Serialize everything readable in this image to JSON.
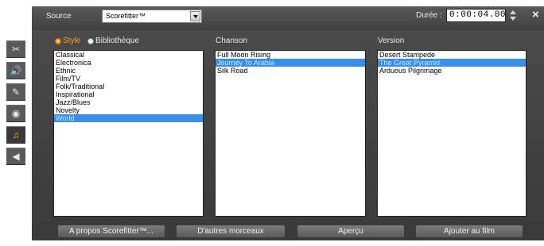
{
  "header": {
    "source_label": "Source",
    "source_value": "Scorefitter™",
    "duration_label": "Durée :",
    "duration_value": "0:00:04.00",
    "close_glyph": "×"
  },
  "sidebar": {
    "tools": [
      {
        "icon": "scissors-icon",
        "glyph": "✂"
      },
      {
        "icon": "speaker-icon",
        "glyph": "🔊"
      },
      {
        "icon": "brush-icon",
        "glyph": "✎"
      },
      {
        "icon": "disc-icon",
        "glyph": "◉"
      },
      {
        "icon": "music-note-icon",
        "glyph": "♫"
      },
      {
        "icon": "video-icon",
        "glyph": "◀"
      }
    ]
  },
  "filter": {
    "style_label": "Style",
    "library_label": "Bibliothèque",
    "selected": "Style"
  },
  "styles": {
    "items": [
      "Classical",
      "Electronica",
      "Ethnic",
      "Film/TV",
      "Folk/Traditional",
      "Inspirational",
      "Jazz/Blues",
      "Novelty",
      "World"
    ],
    "selected": "World"
  },
  "songs": {
    "header": "Chanson",
    "items": [
      "Full Moon Rising",
      "Journey To Arabia",
      "Silk Road"
    ],
    "selected": "Journey To Arabia"
  },
  "versions": {
    "header": "Version",
    "items": [
      "Desert Stampede",
      "The Great Pyramid",
      "Arduous Pilgrimage"
    ],
    "selected": "The Great Pyramid"
  },
  "buttons": {
    "about": "A propos Scorefitter™...",
    "more_tracks": "D'autres morceaux",
    "preview": "Aperçu",
    "add_to_movie": "Ajouter au film"
  },
  "colors": {
    "accent": "#f4a23a",
    "selection": "#3a8ee6"
  }
}
